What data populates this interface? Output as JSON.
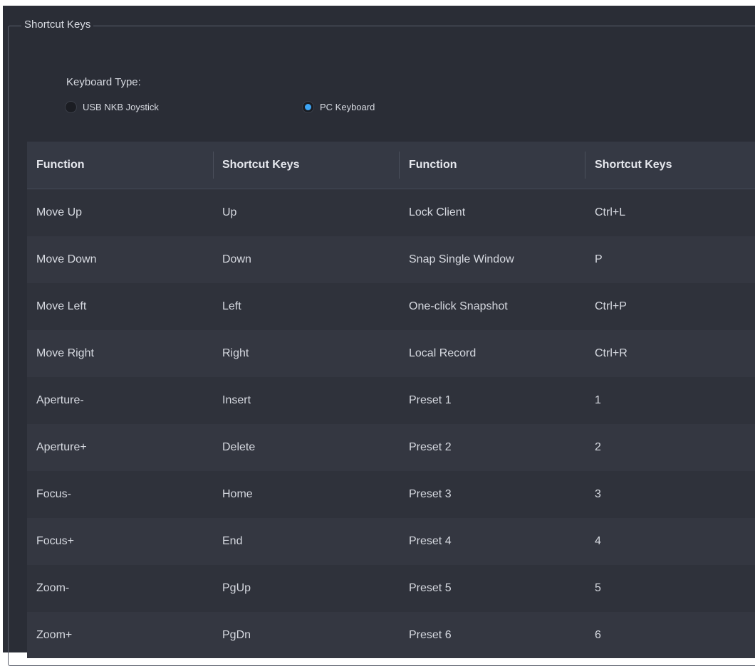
{
  "group": {
    "title": "Shortcut Keys"
  },
  "keyboard": {
    "label": "Keyboard Type:",
    "options": [
      {
        "label": "USB NKB Joystick",
        "checked": false
      },
      {
        "label": "PC Keyboard",
        "checked": true
      }
    ]
  },
  "table": {
    "headers": [
      "Function",
      "Shortcut Keys",
      "Function",
      "Shortcut Keys"
    ],
    "rows": [
      [
        "Move Up",
        "Up",
        "Lock Client",
        "Ctrl+L"
      ],
      [
        "Move Down",
        "Down",
        "Snap Single Window",
        "P"
      ],
      [
        "Move Left",
        "Left",
        "One-click Snapshot",
        "Ctrl+P"
      ],
      [
        "Move Right",
        "Right",
        "Local Record",
        "Ctrl+R"
      ],
      [
        "Aperture-",
        "Insert",
        "Preset 1",
        "1"
      ],
      [
        "Aperture+",
        "Delete",
        "Preset 2",
        "2"
      ],
      [
        "Focus-",
        "Home",
        "Preset 3",
        "3"
      ],
      [
        "Focus+",
        "End",
        "Preset 4",
        "4"
      ],
      [
        "Zoom-",
        "PgUp",
        "Preset 5",
        "5"
      ],
      [
        "Zoom+",
        "PgDn",
        "Preset 6",
        "6"
      ]
    ]
  },
  "colors": {
    "panel_bg": "#2a2d36",
    "accent": "#3ca4f4",
    "header_bg": "#353944"
  }
}
